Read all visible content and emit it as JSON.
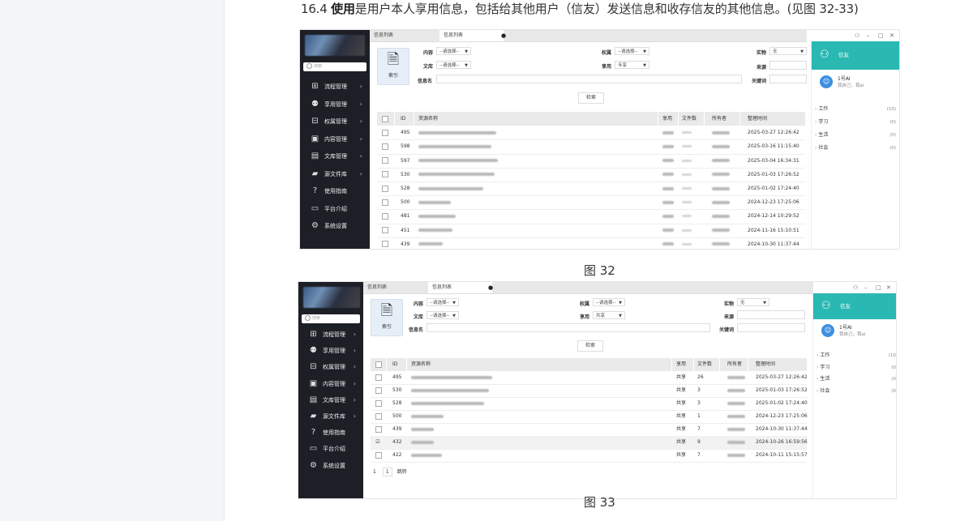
{
  "page": {
    "heading_prefix": "16.4 ",
    "heading_bold": "使用",
    "heading_rest": "是用户本人享用信息，包括给其他用户（信友）发送信息和收存信友的其他信息。(见图 32-33)",
    "caption1": "图 32",
    "caption2": "图 33"
  },
  "app": {
    "search_placeholder": "搜索",
    "nav": [
      {
        "label": "流程管理",
        "icon": "flow-icon"
      },
      {
        "label": "享用管理",
        "icon": "share-icon"
      },
      {
        "label": "权属管理",
        "icon": "permission-icon"
      },
      {
        "label": "内容管理",
        "icon": "content-icon"
      },
      {
        "label": "文库管理",
        "icon": "library-icon"
      },
      {
        "label": "源文件库",
        "icon": "folder-icon"
      },
      {
        "label": "使用指南",
        "icon": "help-icon"
      },
      {
        "label": "平台介绍",
        "icon": "id-card-icon"
      },
      {
        "label": "系统设置",
        "icon": "gear-icon"
      }
    ],
    "tabs": [
      "信息列表",
      "信息列表"
    ],
    "index_label": "索引",
    "filters": {
      "content_label": "内容",
      "library_label": "文库",
      "name_label": "信息名",
      "owner_label": "权属",
      "share_label": "享用",
      "object_label": "实物",
      "source_label": "来源",
      "keyword_label": "关键词",
      "placeholder": "--请选择--",
      "object_value": "无",
      "share_value_1": "专享",
      "share_value_2": "共享",
      "search_button": "检索"
    },
    "columns": {
      "id": "ID",
      "name": "资源名称",
      "share": "享用",
      "files": "文件数",
      "owner": "所有者",
      "time": "整理时间"
    },
    "chat": {
      "title": "信友",
      "bot_name": "1号AI",
      "bot_status": "我自己，我ai",
      "groups": [
        {
          "name": "工作",
          "count": "(10)"
        },
        {
          "name": "学习",
          "count": "(0)"
        },
        {
          "name": "生活",
          "count": "(0)"
        },
        {
          "name": "社会",
          "count": "(0)"
        }
      ]
    }
  },
  "table1": [
    {
      "id": "495",
      "time": "2025-03-27 12:26:42"
    },
    {
      "id": "598",
      "time": "2025-03-16 11:15:40"
    },
    {
      "id": "597",
      "time": "2025-03-04 16:34:31"
    },
    {
      "id": "530",
      "time": "2025-01-03 17:26:52"
    },
    {
      "id": "528",
      "time": "2025-01-02 17:24:40"
    },
    {
      "id": "500",
      "time": "2024-12-23 17:25:06"
    },
    {
      "id": "481",
      "time": "2024-12-14 10:29:52"
    },
    {
      "id": "451",
      "time": "2024-11-16 15:10:51"
    },
    {
      "id": "439",
      "time": "2024-10-30 11:37:44"
    }
  ],
  "table2": [
    {
      "id": "495",
      "share": "共享",
      "files": "26",
      "time": "2025-03-27 12:26:42",
      "checked": ""
    },
    {
      "id": "530",
      "share": "共享",
      "files": "3",
      "time": "2025-01-03 17:26:52",
      "checked": ""
    },
    {
      "id": "528",
      "share": "共享",
      "files": "3",
      "time": "2025-01-02 17:24:40",
      "checked": ""
    },
    {
      "id": "500",
      "share": "共享",
      "files": "1",
      "time": "2024-12-23 17:25:06",
      "checked": ""
    },
    {
      "id": "439",
      "share": "共享",
      "files": "7",
      "time": "2024-10-30 11:37:44",
      "checked": ""
    },
    {
      "id": "432",
      "share": "共享",
      "files": "9",
      "time": "2024-10-26 16:59:56",
      "checked": "☑"
    },
    {
      "id": "422",
      "share": "共享",
      "files": "7",
      "time": "2024-10-11 15:15:57",
      "checked": ""
    }
  ],
  "pager": {
    "current": "1",
    "page": "1",
    "jump": "跳转"
  }
}
